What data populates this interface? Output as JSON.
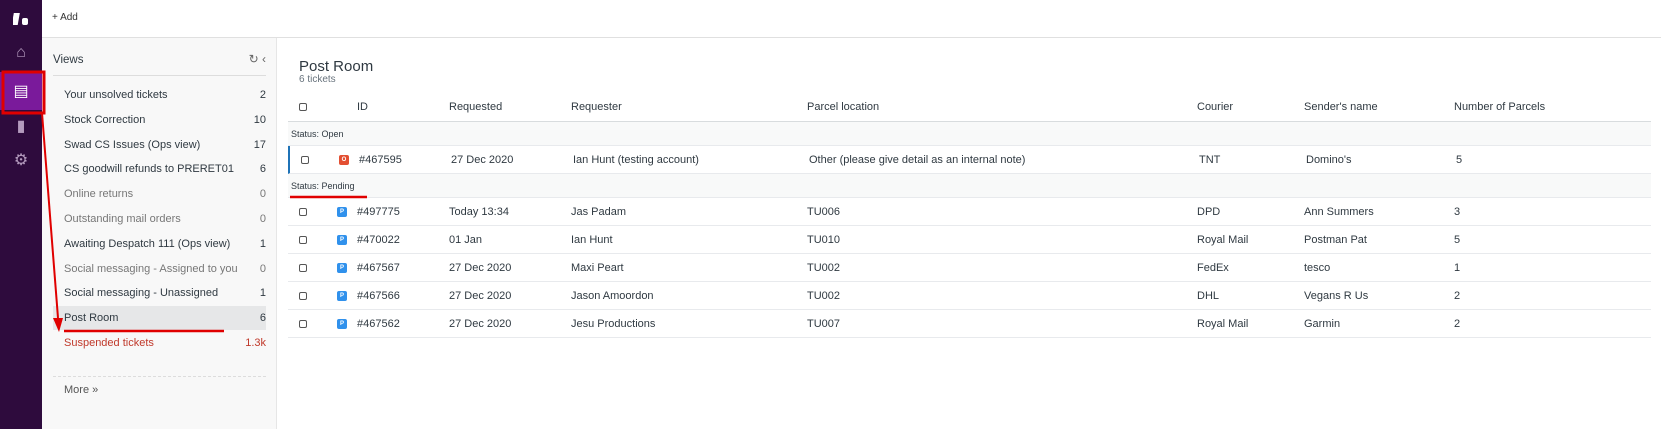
{
  "topbar": {
    "add_label": "+ Add"
  },
  "views": {
    "title": "Views",
    "more": "More »",
    "items": [
      {
        "label": "Your unsolved tickets",
        "count": "2"
      },
      {
        "label": "Stock Correction",
        "count": "10"
      },
      {
        "label": "Swad CS Issues (Ops view)",
        "count": "17"
      },
      {
        "label": "CS goodwill refunds to PRERET01",
        "count": "6"
      },
      {
        "label": "Online returns",
        "count": "0"
      },
      {
        "label": "Outstanding mail orders",
        "count": "0"
      },
      {
        "label": "Awaiting Despatch 111 (Ops view)",
        "count": "1"
      },
      {
        "label": "Social messaging - Assigned to you",
        "count": "0"
      },
      {
        "label": "Social messaging - Unassigned",
        "count": "1"
      },
      {
        "label": "Post Room",
        "count": "6"
      },
      {
        "label": "Suspended tickets",
        "count": "1.3k"
      }
    ]
  },
  "main": {
    "title": "Post Room",
    "subtitle": "6 tickets",
    "columns": [
      "ID",
      "Requested",
      "Requester",
      "Parcel location",
      "Courier",
      "Sender's name",
      "Number of Parcels"
    ],
    "groups": [
      {
        "label": "Status: Open",
        "rows": [
          {
            "badge": "O",
            "id": "#467595",
            "requested": "27 Dec 2020",
            "requester": "Ian Hunt (testing account)",
            "location": "Other (please give detail as an internal note)",
            "courier": "TNT",
            "sender": "Domino's",
            "parcels": "5"
          }
        ]
      },
      {
        "label": "Status: Pending",
        "rows": [
          {
            "badge": "P",
            "id": "#497775",
            "requested": "Today 13:34",
            "requester": "Jas Padam",
            "location": "TU006",
            "courier": "DPD",
            "sender": "Ann Summers",
            "parcels": "3"
          },
          {
            "badge": "P",
            "id": "#470022",
            "requested": "01 Jan",
            "requester": "Ian Hunt",
            "location": "TU010",
            "courier": "Royal Mail",
            "sender": "Postman Pat",
            "parcels": "5"
          },
          {
            "badge": "P",
            "id": "#467567",
            "requested": "27 Dec 2020",
            "requester": "Maxi Peart",
            "location": "TU002",
            "courier": "FedEx",
            "sender": "tesco",
            "parcels": "1"
          },
          {
            "badge": "P",
            "id": "#467566",
            "requested": "27 Dec 2020",
            "requester": "Jason Amoordon",
            "location": "TU002",
            "courier": "DHL",
            "sender": "Vegans R Us",
            "parcels": "2"
          },
          {
            "badge": "P",
            "id": "#467562",
            "requested": "27 Dec 2020",
            "requester": "Jesu Productions",
            "location": "TU007",
            "courier": "Royal Mail",
            "sender": "Garmin",
            "parcels": "2"
          }
        ]
      }
    ]
  },
  "colors": {
    "open": "#e34f32",
    "pending": "#3091ec",
    "annotation": "#e00000"
  }
}
